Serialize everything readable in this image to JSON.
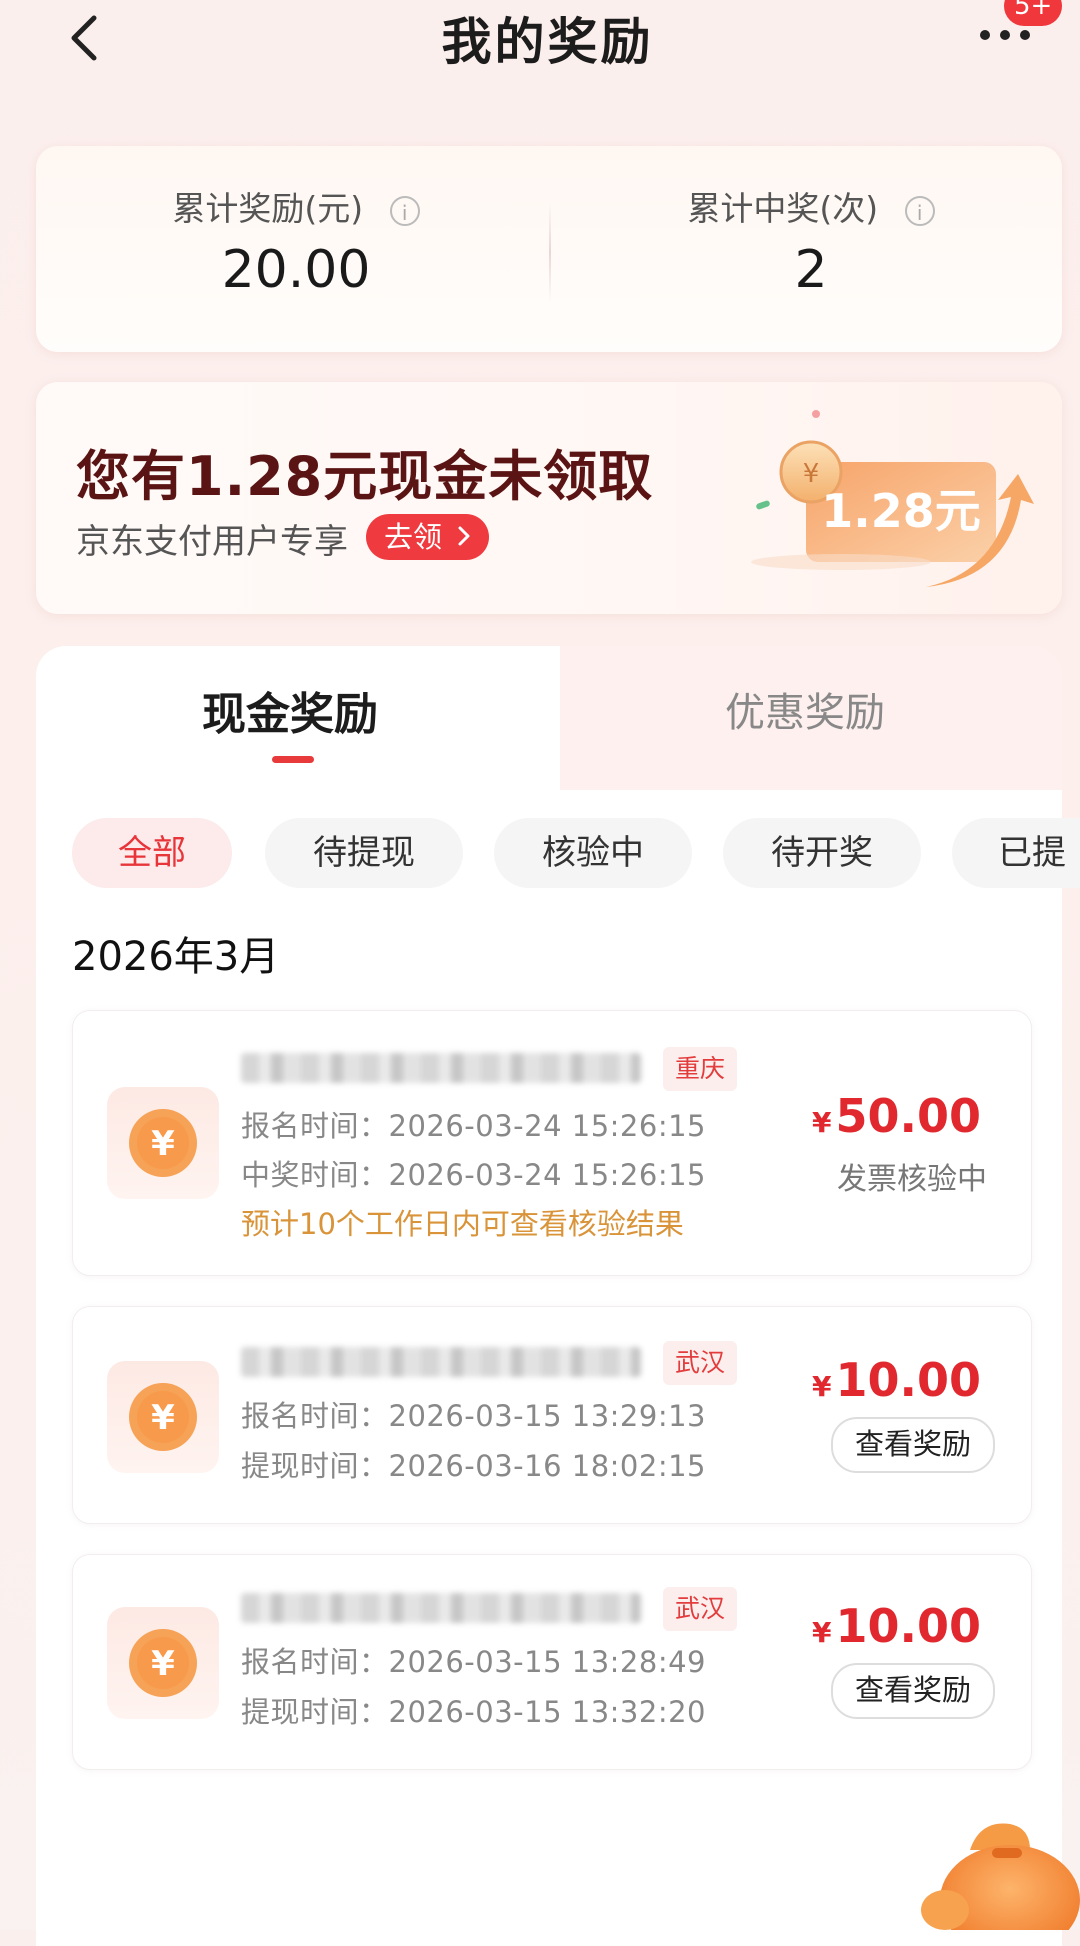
{
  "header": {
    "title": "我的奖励",
    "badge": "5+"
  },
  "stats": {
    "total_reward_label": "累计奖励(元)",
    "total_reward_value": "20.00",
    "total_win_label": "累计中奖(次)",
    "total_win_value": "2",
    "info_glyph": "i"
  },
  "promo": {
    "title": "您有1.28元现金未领取",
    "subtitle": "京东支付用户专享",
    "button": "去领",
    "art_label": "1.28元"
  },
  "tabs": [
    {
      "label": "现金奖励",
      "active": true
    },
    {
      "label": "优惠奖励",
      "active": false
    }
  ],
  "filters": [
    "全部",
    "待提现",
    "核验中",
    "待开奖",
    "已提"
  ],
  "month": "2026年3月",
  "records": [
    {
      "city": "重庆",
      "line1": "报名时间：2026-03-24 15:26:15",
      "line2": "中奖时间：2026-03-24 15:26:15",
      "note": "预计10个工作日内可查看核验结果",
      "currency": "¥",
      "amount": "50.00",
      "status": "发票核验中"
    },
    {
      "city": "武汉",
      "line1": "报名时间：2026-03-15 13:29:13",
      "line2": "提现时间：2026-03-16 18:02:15",
      "currency": "¥",
      "amount": "10.00",
      "button": "查看奖励"
    },
    {
      "city": "武汉",
      "line1": "报名时间：2026-03-15 13:28:49",
      "line2": "提现时间：2026-03-15 13:32:20",
      "currency": "¥",
      "amount": "10.00",
      "button": "查看奖励"
    }
  ],
  "icons": [
    "back-icon",
    "more-icon",
    "info-icon",
    "coin-icon",
    "chevron-right-icon",
    "lucky-bag-icon"
  ],
  "colors": {
    "accent": "#e8353a",
    "note": "#d9943a"
  }
}
